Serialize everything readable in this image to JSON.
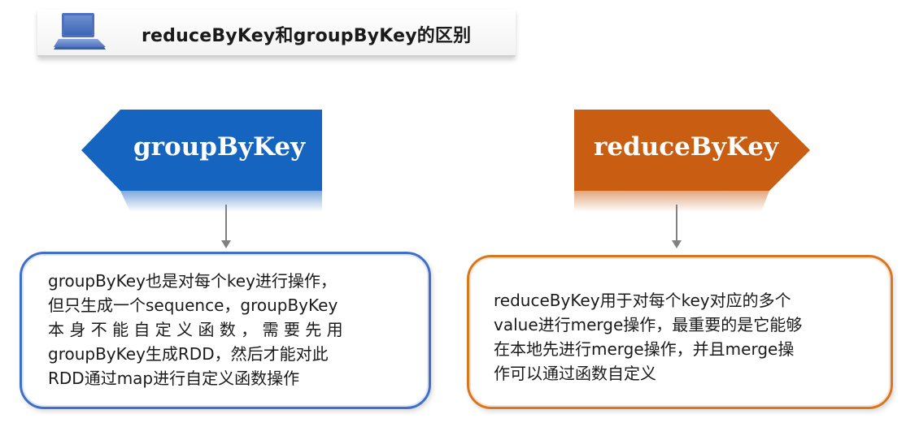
{
  "title": {
    "text": "reduceByKey和groupByKey的区别",
    "icon": "laptop-icon"
  },
  "colors": {
    "blue": "#1565c0",
    "orange": "#c95d12",
    "blue_border": "#3f6fc9",
    "orange_border": "#d9771f"
  },
  "left": {
    "banner_label": "groupByKey",
    "lines": [
      "groupByKey也是对每个key进行操作，",
      "但只生成一个sequence，groupByKey",
      "本 身 不 能 自 定 义 函 数 ， 需 要 先 用",
      "groupByKey生成RDD，然后才能对此",
      "RDD通过map进行自定义函数操作"
    ]
  },
  "right": {
    "banner_label": "reduceByKey",
    "lines": [
      "reduceByKey用于对每个key对应的多个",
      "value进行merge操作，最重要的是它能够",
      "在本地先进行merge操作，并且merge操",
      "作可以通过函数自定义"
    ]
  }
}
